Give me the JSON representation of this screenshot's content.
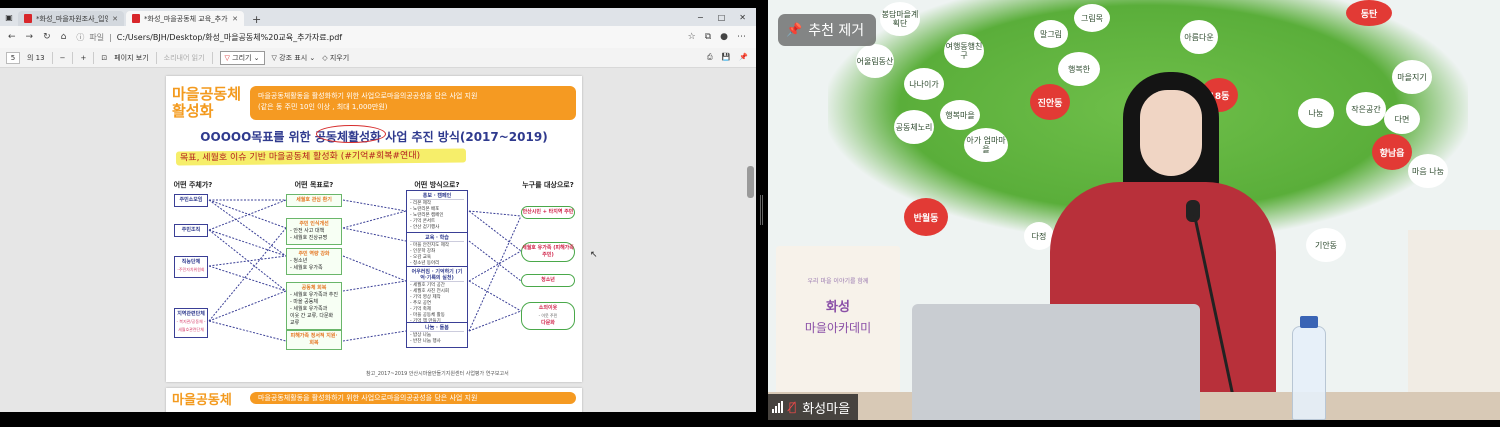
{
  "browser": {
    "tabs": [
      {
        "title": "*화성_마을자원조사_입영호.pdf",
        "active": false
      },
      {
        "title": "*화성_마을공동체 교육_추가자료.pdf",
        "active": true
      }
    ],
    "new_tab": "+",
    "window_controls": {
      "minimize": "−",
      "maximize": "□",
      "close": "✕"
    },
    "nav": {
      "back": "←",
      "forward": "→",
      "refresh": "↻",
      "home": "⌂"
    },
    "address": {
      "info": "ⓘ",
      "scheme_label": "파일",
      "url": "C:/Users/BJH/Desktop/화성_마을공동체%20교육_추가자료.pdf"
    },
    "toolbar_icons": {
      "favorite": "☆",
      "collections": "⧉",
      "profile": "●",
      "menu": "⋯"
    }
  },
  "pdf_toolbar": {
    "current_page": "5",
    "total_pages": "의 13",
    "zoom_out": "−",
    "zoom_in": "+",
    "fit": "⊡",
    "page_view": "페이지 보기",
    "read_aloud": "소리내어 읽기",
    "draw": "그리기",
    "highlight": "강조 표시",
    "erase": "지우기",
    "print": "⎙",
    "save": "💾",
    "pin": "📌"
  },
  "pdf_page": {
    "section_title": "마을공동체 활성화",
    "banner_lines": [
      "마을공동체활동을 활성화하기 위한 사업으로마을의공공성을 담은 사업 지원",
      "(같은 동 주민 10인 이상 , 최대 1,000만원)"
    ],
    "main_heading": "OOOOO목표를 위한 공동체활성화 사업 추진 방식(2017~2019)",
    "hand_note": "목표, 세월호 이슈 기반 마을공동체 활성화 (#기억#회복#연대)",
    "columns": [
      "어떤 주체가?",
      "어떤 목표로?",
      "어떤 방식으로?",
      "누구를 대상으로?"
    ],
    "subjects": [
      {
        "label": "주민소모임",
        "sub": ""
      },
      {
        "label": "주민조직",
        "sub": ""
      },
      {
        "label": "직능단체",
        "sub": "-주민자치위원회"
      },
      {
        "label": "지역관련단체",
        "sub": "- 복지관/공동체\n- 세월호관련단체"
      }
    ],
    "goals": [
      {
        "title": "세월호 관심 환기",
        "items": []
      },
      {
        "title": "주민 인식개선",
        "items": [
          "- 안전 사고 대책",
          "- 세월호 진상규명"
        ]
      },
      {
        "title": "주민 역량 강화",
        "items": [
          "- 청소년",
          "- 세월호 유가족"
        ]
      },
      {
        "title": "공동체 회복",
        "items": [
          "- 세월호 유가족과 추진",
          "- 마을 공동체",
          "- 세월호 유가족과",
          "  이웃 간 교류, 다문화 교류"
        ]
      },
      {
        "title": "피해가족 정서적 지원·회복",
        "items": []
      }
    ],
    "methods": [
      {
        "title": "홍보 · 캠페인",
        "items": [
          "- 리본 제작",
          "- 노란리본 배포",
          "- 노란리본 캠페인",
          "- 기억 콘서트",
          "- 안산 걷기행사"
        ]
      },
      {
        "title": "교육 · 학습",
        "items": [
          "- 마을 안전지도 제작",
          "- 인문학 강좌",
          "- 오감 교육",
          "- 청소년 동아리"
        ]
      },
      {
        "title": "어우러짐 · 기억하기 (기억·기록의 실천)",
        "items": [
          "- 세월호 기억 공간",
          "- 세월호 사진 전시회",
          "- 기억 영상 제작",
          "- 추모 공연",
          "- 기억 축제",
          "- 마을 공동체 활동",
          "- 기억 책 만들기"
        ]
      },
      {
        "title": "나눔 · 돌봄",
        "items": [
          "- 밥상 나눔",
          "- 반찬 나눔 행사"
        ]
      }
    ],
    "targets": [
      {
        "label": "안산시민 + 타지역 주민",
        "sub": ""
      },
      {
        "label": "세월호 유가족 (피해가족 주민)",
        "sub": ""
      },
      {
        "label": "청소년",
        "sub": ""
      },
      {
        "label": "소외이웃",
        "sub": "- 이웃 주민",
        "sub2": "다문화"
      }
    ],
    "source": "참고_2017~2019 안산시마을만들기지원센터 사업평가 연구보고서",
    "next_page_title": "마을공동체",
    "next_page_banner": "마을공동체활동을 활성화하기 위한 사업으로마을의공공성을 담은 사업 지원"
  },
  "camera": {
    "recommend_label": "추천 제거",
    "participant_name": "화성마을",
    "banner_title": "화성",
    "banner_subtitle": "마을아카데미",
    "banner_tagline": "우리 마을 이야기를 함께",
    "leaves": [
      "봉담마을계획단",
      "어울림동산",
      "여행동행친구",
      "나나이가",
      "아름다운",
      "그림목",
      "말그림",
      "행복한",
      "아가 엄마마을",
      "작은공간",
      "진안동",
      "행복마을",
      "마을지기",
      "공동체노리",
      "18동",
      "나눔",
      "다면",
      "향남읍",
      "반월동",
      "다정",
      "기안동",
      "마음 나눔"
    ],
    "apples": [
      "진안동",
      "18동",
      "향남읍",
      "반월동",
      "동탄"
    ],
    "colors": {
      "tree": "#5aae3a",
      "apple": "#e23a35",
      "shirt": "#b8303a"
    }
  }
}
